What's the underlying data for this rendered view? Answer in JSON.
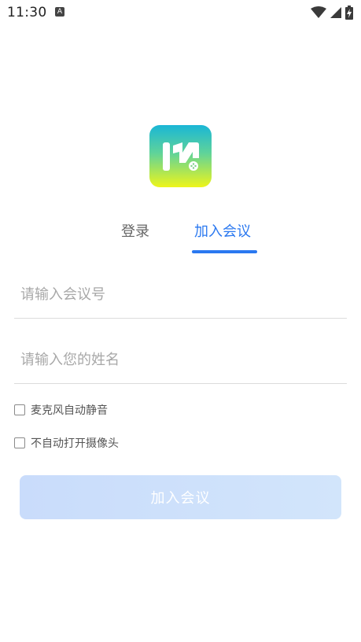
{
  "status_bar": {
    "time": "11:30",
    "icons": [
      "notification-a-icon",
      "wifi-icon",
      "signal-icon",
      "battery-icon"
    ]
  },
  "logo": {
    "icon": "app-logo-icon"
  },
  "tabs": [
    {
      "label": "登录",
      "active": false
    },
    {
      "label": "加入会议",
      "active": true
    }
  ],
  "form": {
    "meeting_number": {
      "value": "",
      "placeholder": "请输入会议号"
    },
    "name": {
      "value": "",
      "placeholder": "请输入您的姓名"
    },
    "options": [
      {
        "label": "麦克风自动静音",
        "checked": false
      },
      {
        "label": "不自动打开摄像头",
        "checked": false
      }
    ],
    "submit_label": "加入会议"
  },
  "colors": {
    "accent": "#2a78f0",
    "button_disabled": "#cfe1fb",
    "placeholder": "#a8a8a8"
  }
}
